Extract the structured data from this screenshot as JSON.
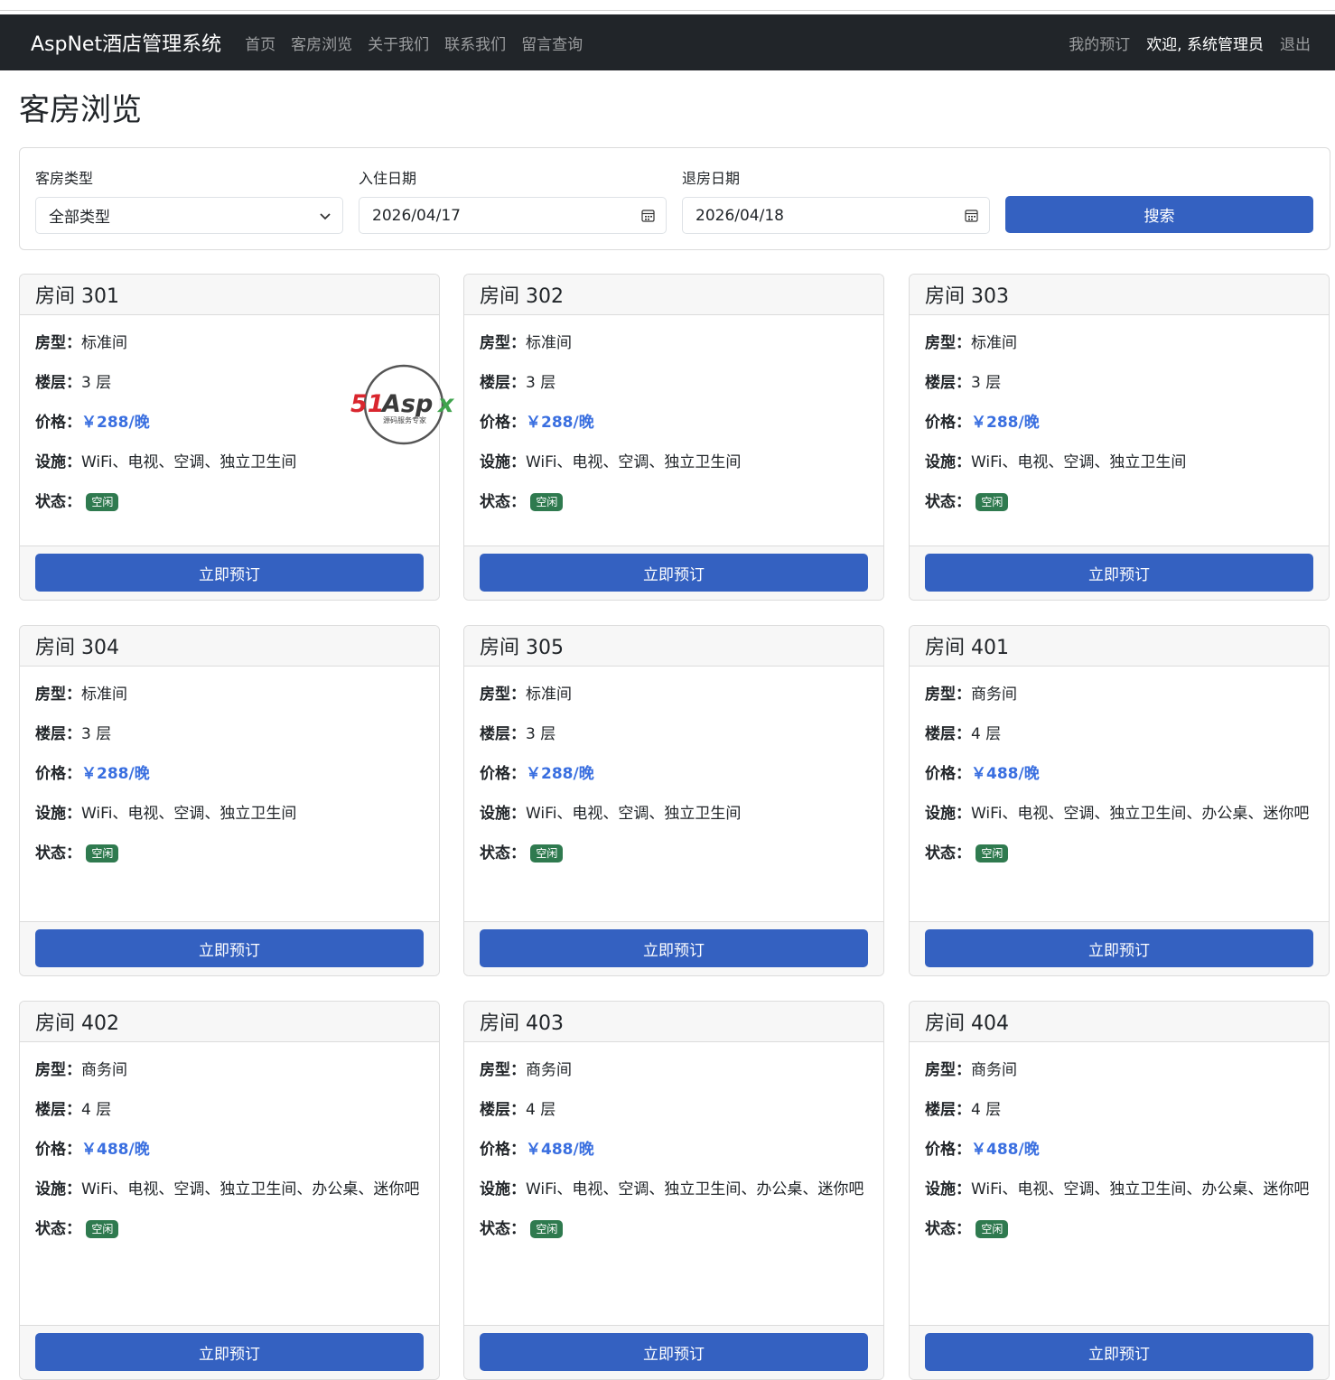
{
  "navbar": {
    "brand": "AspNet酒店管理系统",
    "links": [
      "首页",
      "客房浏览",
      "关于我们",
      "联系我们",
      "留言查询"
    ],
    "my_booking": "我的预订",
    "welcome": "欢迎, 系统管理员",
    "logout": "退出"
  },
  "page": {
    "title": "客房浏览"
  },
  "search": {
    "room_type_label": "客房类型",
    "room_type_value": "全部类型",
    "checkin_label": "入住日期",
    "checkin_value": "2026/04/17",
    "checkout_label": "退房日期",
    "checkout_value": "2026/04/18",
    "search_button": "搜索"
  },
  "labels": {
    "type": "房型：",
    "floor": "楼层：",
    "price": "价格：",
    "facilities": "设施：",
    "status": "状态：",
    "book": "立即预订"
  },
  "watermark": {
    "brand": "51Aspx",
    "tagline": "源码服务专家"
  },
  "rooms": [
    {
      "name": "房间 301",
      "type": "标准间",
      "floor": "3 层",
      "price": "￥288/晚",
      "facilities": "WiFi、电视、空调、独立卫生间",
      "status": "空闲"
    },
    {
      "name": "房间 302",
      "type": "标准间",
      "floor": "3 层",
      "price": "￥288/晚",
      "facilities": "WiFi、电视、空调、独立卫生间",
      "status": "空闲"
    },
    {
      "name": "房间 303",
      "type": "标准间",
      "floor": "3 层",
      "price": "￥288/晚",
      "facilities": "WiFi、电视、空调、独立卫生间",
      "status": "空闲"
    },
    {
      "name": "房间 304",
      "type": "标准间",
      "floor": "3 层",
      "price": "￥288/晚",
      "facilities": "WiFi、电视、空调、独立卫生间",
      "status": "空闲"
    },
    {
      "name": "房间 305",
      "type": "标准间",
      "floor": "3 层",
      "price": "￥288/晚",
      "facilities": "WiFi、电视、空调、独立卫生间",
      "status": "空闲"
    },
    {
      "name": "房间 401",
      "type": "商务间",
      "floor": "4 层",
      "price": "￥488/晚",
      "facilities": "WiFi、电视、空调、独立卫生间、办公桌、迷你吧",
      "status": "空闲"
    },
    {
      "name": "房间 402",
      "type": "商务间",
      "floor": "4 层",
      "price": "￥488/晚",
      "facilities": "WiFi、电视、空调、独立卫生间、办公桌、迷你吧",
      "status": "空闲"
    },
    {
      "name": "房间 403",
      "type": "商务间",
      "floor": "4 层",
      "price": "￥488/晚",
      "facilities": "WiFi、电视、空调、独立卫生间、办公桌、迷你吧",
      "status": "空闲"
    },
    {
      "name": "房间 404",
      "type": "商务间",
      "floor": "4 层",
      "price": "￥488/晚",
      "facilities": "WiFi、电视、空调、独立卫生间、办公桌、迷你吧",
      "status": "空闲"
    }
  ]
}
